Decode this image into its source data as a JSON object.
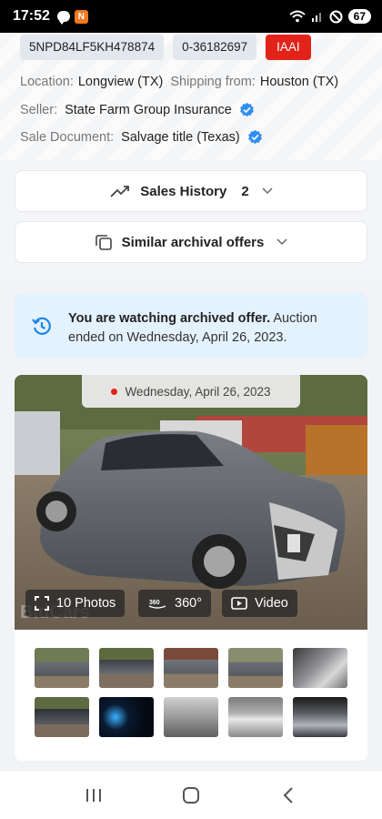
{
  "status_bar": {
    "time": "17:52",
    "battery": "67",
    "app_badge": "N"
  },
  "tags": {
    "vin": "5NPD84LF5KH478874",
    "lot": "0-36182697",
    "auction": "IAAI"
  },
  "info": {
    "location_label": "Location:",
    "location_value": "Longview (TX)",
    "shipping_label": "Shipping from:",
    "shipping_value": "Houston (TX)",
    "seller_label": "Seller:",
    "seller_value": "State Farm Group Insurance",
    "document_label": "Sale Document:",
    "document_value": "Salvage title (Texas)"
  },
  "sales_history": {
    "label": "Sales History",
    "count": "2"
  },
  "similar": {
    "label": "Similar archival offers"
  },
  "notice": {
    "bold": "You are watching archived offer.",
    "rest": " Auction ended on Wednesday, April 26, 2023."
  },
  "photo": {
    "date": "Wednesday, April 26, 2023",
    "photos_label": "10 Photos",
    "view360_label": "360°",
    "video_label": "Video",
    "watermark": "BidCars"
  },
  "thumbnails": [
    {
      "name": "thumb-1"
    },
    {
      "name": "thumb-2"
    },
    {
      "name": "thumb-3"
    },
    {
      "name": "thumb-4"
    },
    {
      "name": "thumb-5"
    },
    {
      "name": "thumb-6"
    },
    {
      "name": "thumb-7"
    },
    {
      "name": "thumb-8"
    },
    {
      "name": "thumb-9"
    },
    {
      "name": "thumb-10"
    }
  ],
  "colors": {
    "accent_red": "#e2231a",
    "verified_blue": "#2f8ef0",
    "notice_bg": "#e4f2fd"
  },
  "icons": [
    "chat-icon",
    "wifi-icon",
    "signal-icon",
    "dnd-icon",
    "verified-icon",
    "trend-icon",
    "chevron-down-icon",
    "copy-icon",
    "history-icon",
    "fullscreen-icon",
    "360-icon",
    "play-icon",
    "recents-icon",
    "home-icon",
    "back-icon"
  ]
}
